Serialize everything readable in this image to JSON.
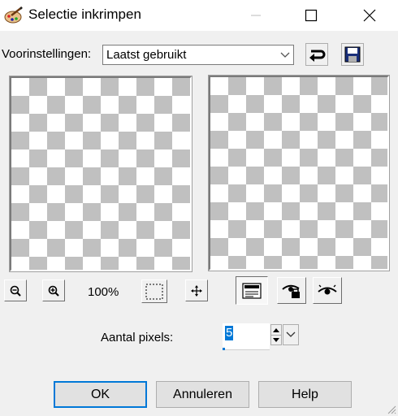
{
  "window": {
    "title": "Selectie inkrimpen",
    "icon": "palette-brush-icon",
    "controls": [
      "minimize-icon",
      "maximize-icon",
      "close-icon"
    ]
  },
  "presets": {
    "label": "Voorinstellingen:",
    "selected": "Laatst gebruikt",
    "reset_icon": "reset-arrow-icon",
    "save_icon": "save-disk-icon"
  },
  "preview_tools": {
    "zoom_out_icon": "zoom-out-icon",
    "zoom_in_icon": "zoom-in-icon",
    "zoom": "100%",
    "fit_icon": "zoom-fit-icon",
    "pan_icon": "pan-move-icon",
    "proof_icon": "proof-icon",
    "auto_proof_icon": "auto-proof-icon",
    "show_icon": "show-eye-icon"
  },
  "settings": {
    "pixels_label": "Aantal pixels:",
    "pixels_value": "5"
  },
  "buttons": {
    "ok": "OK",
    "cancel": "Annuleren",
    "help": "Help"
  },
  "colors": {
    "focus_blue": "#0078d7",
    "checker_gray": "#c0c0c0",
    "dialog_bg": "#f0f0f0"
  }
}
